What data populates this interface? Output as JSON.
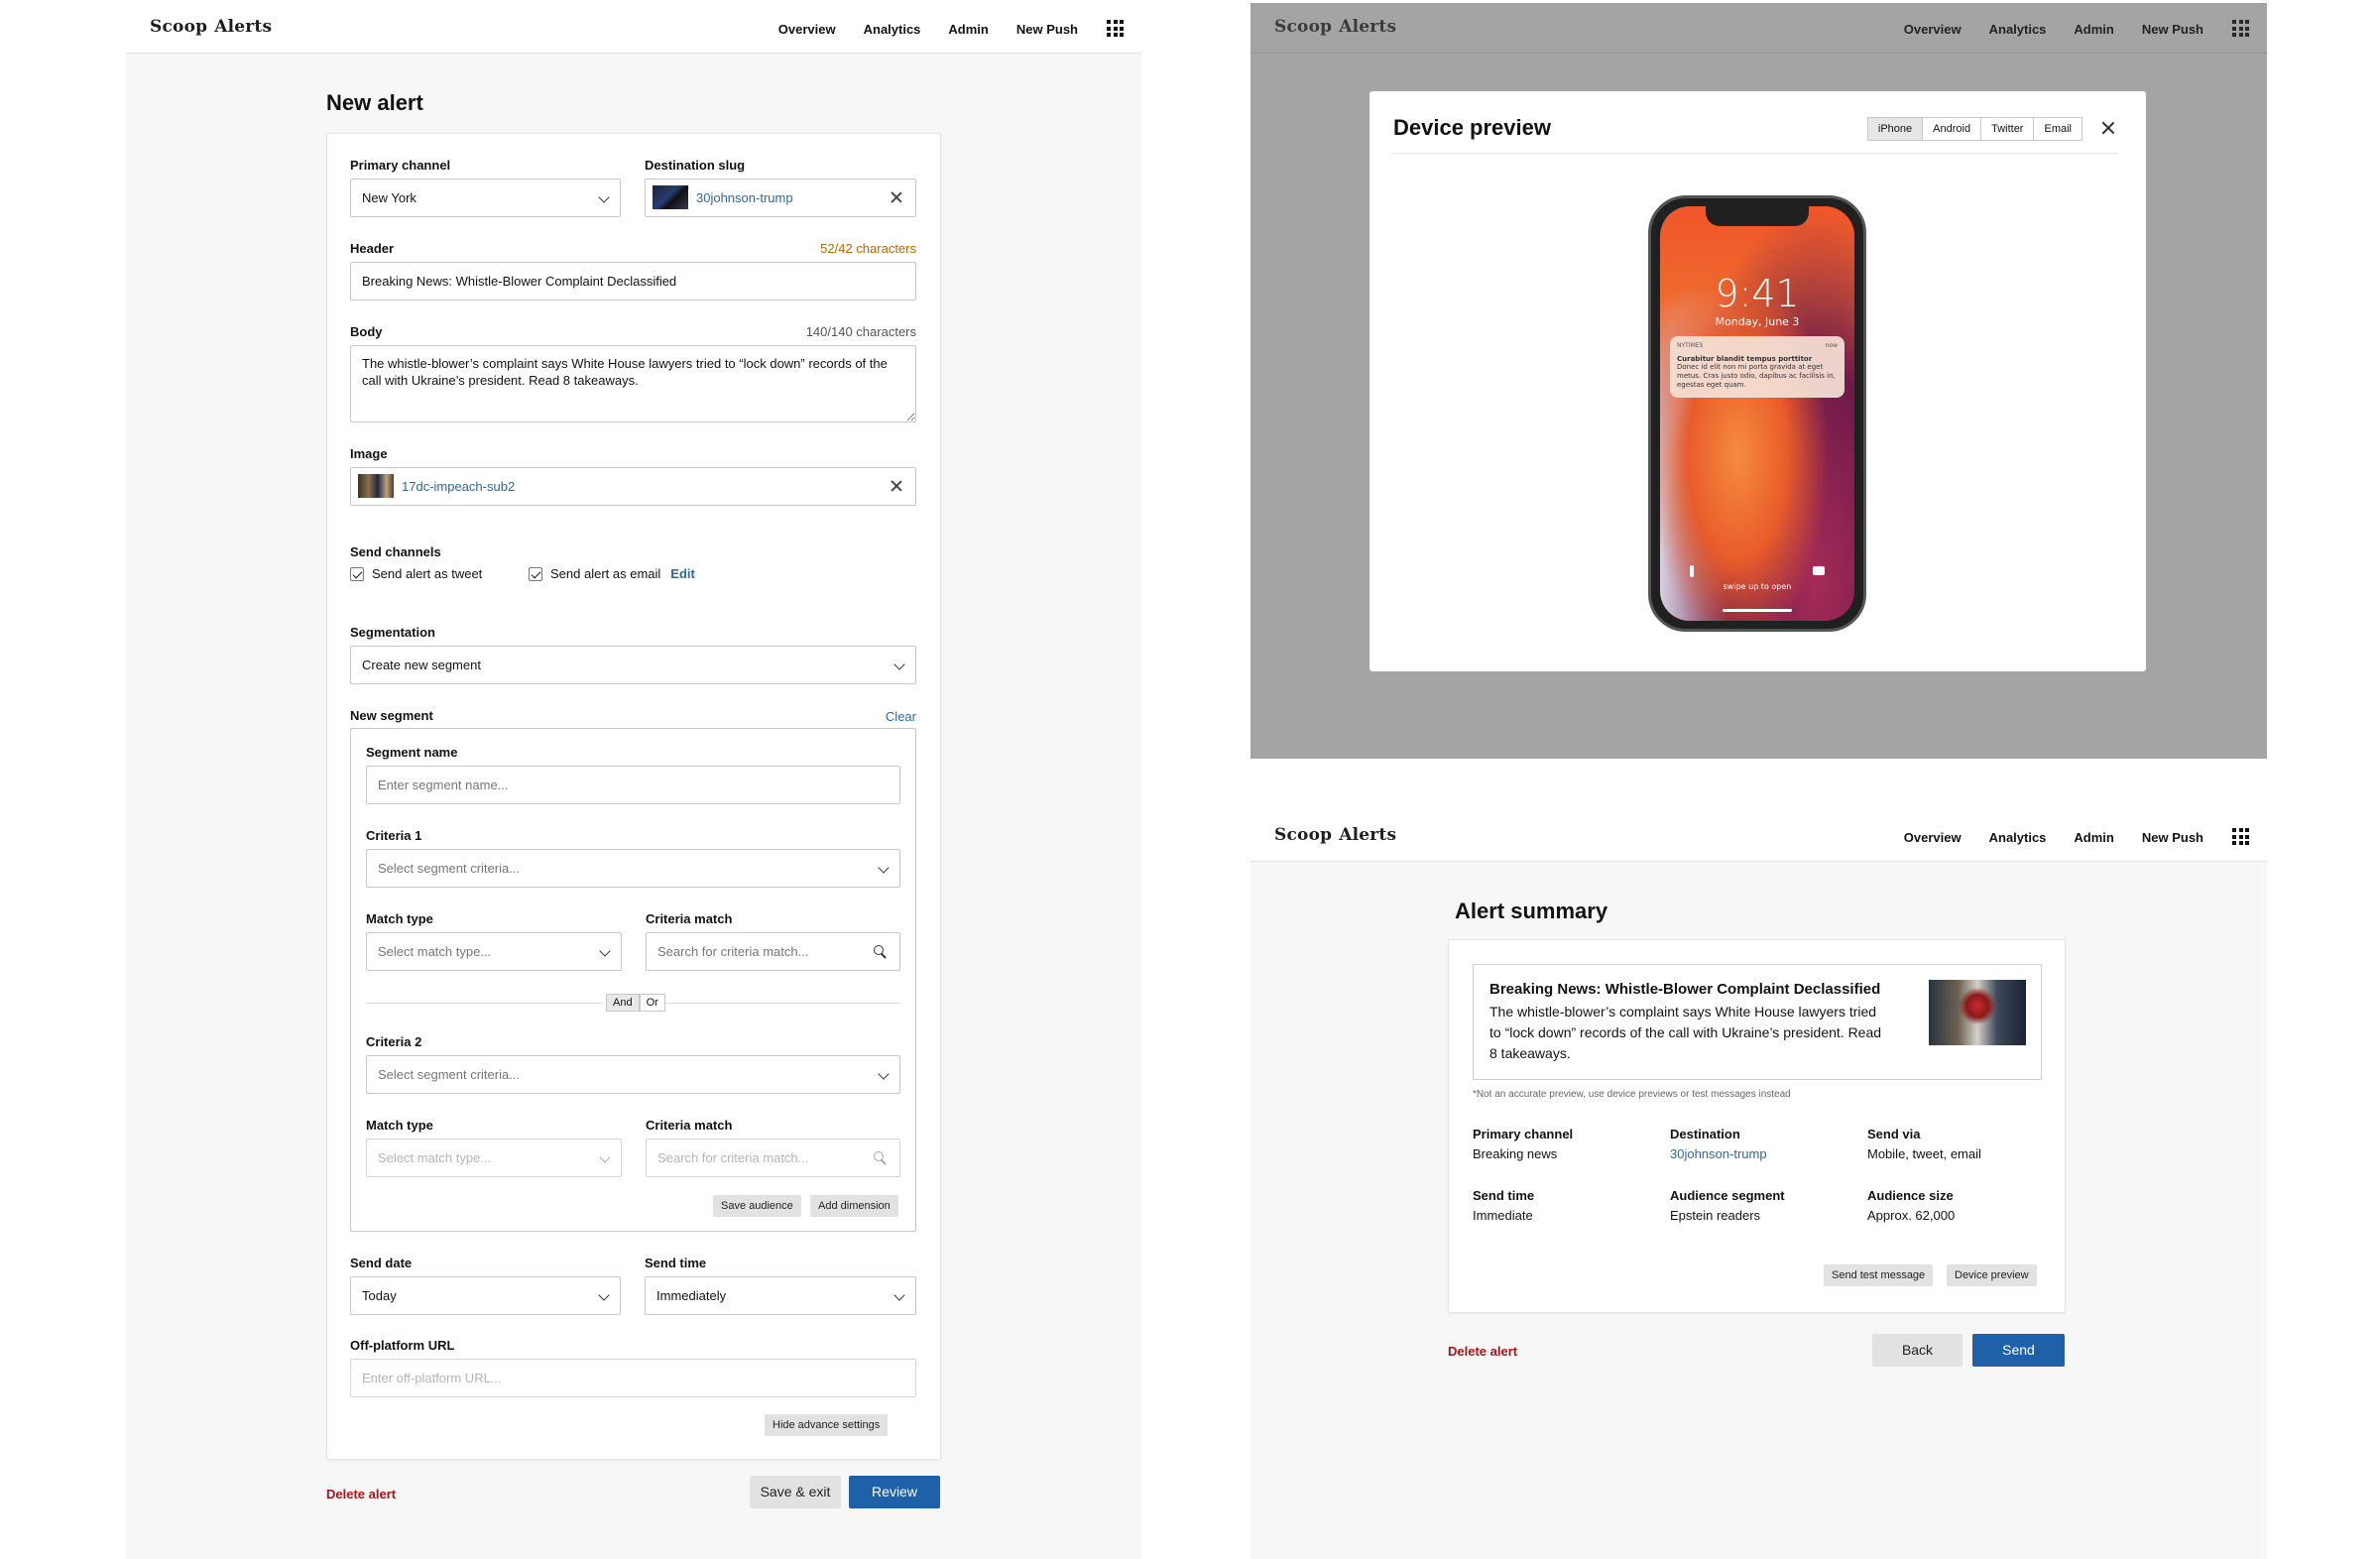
{
  "nav": {
    "logo_a": "Scoop",
    "logo_b": "Alerts",
    "items": [
      "Overview",
      "Analytics",
      "Admin",
      "New Push"
    ]
  },
  "new_alert": {
    "title": "New alert",
    "primary_channel": {
      "label": "Primary channel",
      "value": "New York"
    },
    "destination_slug": {
      "label": "Destination slug",
      "value": "30johnson-trump"
    },
    "header": {
      "label": "Header",
      "count": "52/42 characters",
      "value": "Breaking News: Whistle-Blower Complaint Declassified"
    },
    "body": {
      "label": "Body",
      "count": "140/140 characters",
      "value": "The whistle-blower’s complaint says White House lawyers tried to “lock down” records of the call with Ukraine’s president. Read 8 takeaways."
    },
    "image": {
      "label": "Image",
      "value": "17dc-impeach-sub2"
    },
    "send_channels": {
      "label": "Send channels",
      "tweet": "Send alert as tweet",
      "email": "Send alert as email",
      "edit": "Edit"
    },
    "segmentation": {
      "label": "Segmentation",
      "value": "Create new segment"
    },
    "new_segment": {
      "label": "New segment",
      "clear": "Clear",
      "segment_name": {
        "label": "Segment name",
        "placeholder": "Enter segment name..."
      },
      "criteria1": {
        "label": "Criteria 1",
        "placeholder": "Select segment criteria..."
      },
      "match_type1": {
        "label": "Match type",
        "placeholder": "Select match type..."
      },
      "criteria_match1": {
        "label": "Criteria match",
        "placeholder": "Search for criteria match..."
      },
      "and": "And",
      "or": "Or",
      "criteria2": {
        "label": "Criteria 2",
        "placeholder": "Select segment criteria..."
      },
      "match_type2": {
        "label": "Match type",
        "placeholder": "Select match type..."
      },
      "criteria_match2": {
        "label": "Criteria match",
        "placeholder": "Search for criteria match..."
      },
      "save_audience": "Save audience",
      "add_dimension": "Add dimension"
    },
    "send_date": {
      "label": "Send date",
      "value": "Today"
    },
    "send_time": {
      "label": "Send time",
      "value": "Immediately"
    },
    "off_platform_url": {
      "label": "Off-platform URL",
      "placeholder": "Enter off-platform URL..."
    },
    "hide_advanced": "Hide advance settings",
    "delete": "Delete alert",
    "save_exit": "Save & exit",
    "review": "Review"
  },
  "device_preview": {
    "title": "Device preview",
    "tabs": [
      "iPhone",
      "Android",
      "Twitter",
      "Email"
    ],
    "phone": {
      "time": "9:41",
      "date": "Monday, June 3",
      "notif_app": "NYTIMES",
      "notif_when": "now",
      "notif_title": "Curabitur blandit tempus porttitor",
      "notif_body": "Donec id elit non mi porta gravida at eget metus. Cras justo odio, dapibus ac facilisis in, egestas eget quam.",
      "swipe": "swipe up to open"
    }
  },
  "summary": {
    "title": "Alert summary",
    "headline": "Breaking News: Whistle-Blower Complaint Declassified",
    "body": "The whistle-blower’s complaint says White House lawyers tried to “lock down” records of the call with Ukraine’s president. Read 8 takeaways.",
    "note": "*Not an accurate preview, use device previews or test messages instead",
    "fields": [
      {
        "label": "Primary channel",
        "value": "Breaking news"
      },
      {
        "label": "Destination",
        "value": "30johnson-trump"
      },
      {
        "label": "Send via",
        "value": "Mobile, tweet, email"
      },
      {
        "label": "Send time",
        "value": "Immediate"
      },
      {
        "label": "Audience segment",
        "value": "Epstein readers"
      },
      {
        "label": "Audience size",
        "value": "Approx. 62,000"
      }
    ],
    "send_test": "Send test message",
    "device_preview": "Device preview",
    "delete": "Delete alert",
    "back": "Back",
    "send": "Send"
  }
}
